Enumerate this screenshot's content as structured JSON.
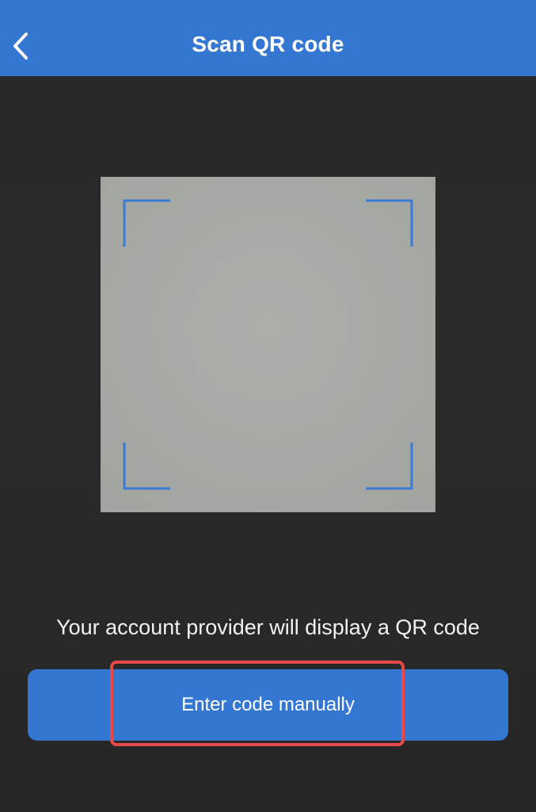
{
  "header": {
    "title": "Scan QR code",
    "back_icon": "chevron-left-icon"
  },
  "scanner": {
    "corner_icon": "scan-corner-bracket",
    "frame_color": "#a8aaa5",
    "bracket_color": "#3a7bd5"
  },
  "hint": {
    "text": "Your account provider will display a QR code"
  },
  "manual_entry": {
    "label": "Enter code manually"
  },
  "colors": {
    "accent": "#3477d2",
    "background": "#2a2a2a",
    "highlight": "#e8484a"
  }
}
